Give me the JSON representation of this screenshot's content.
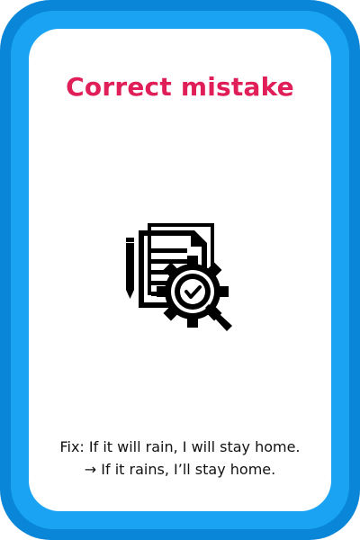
{
  "card": {
    "title": "Correct mistake",
    "icon": "document-gear-magnifier-check-icon",
    "caption_line1": "Fix: If it will rain, I will stay home.",
    "caption_line2": "→ If it rains, I’ll stay home."
  },
  "colors": {
    "frame_outer": "#0a86d8",
    "frame_inner": "#1aa3f2",
    "title": "#e01e57",
    "text": "#111111"
  }
}
